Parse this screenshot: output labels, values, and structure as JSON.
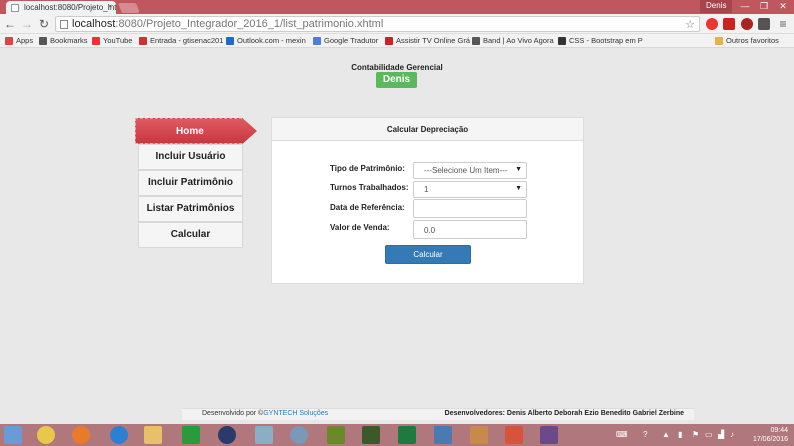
{
  "browser": {
    "tab_title": "localhost:8080/Projeto_Int",
    "tab_close": "×",
    "user_label": "Denis",
    "window_controls": {
      "minimize": "—",
      "maximize": "❐",
      "close": "✕"
    },
    "nav": {
      "back": "←",
      "forward": "→",
      "reload": "↻"
    },
    "url_host": "localhost",
    "url_path": ":8080/Projeto_Integrador_2016_1/list_patrimonio.xhtml",
    "star": "☆",
    "menu": "≡"
  },
  "bookmarks": [
    {
      "label": "Apps",
      "color": "#d44"
    },
    {
      "label": "Bookmarks",
      "color": "#555"
    },
    {
      "label": "YouTube",
      "color": "#e33"
    },
    {
      "label": "Entrada - gtisenac201",
      "color": "#c33"
    },
    {
      "label": "Outlook.com - mexin",
      "color": "#1e6cc7"
    },
    {
      "label": "Google Tradutor",
      "color": "#4a7fd9"
    },
    {
      "label": "Assistir TV Online Grá",
      "color": "#c22"
    },
    {
      "label": "Band | Ao Vivo Agora",
      "color": "#555"
    },
    {
      "label": "CSS - Bootstrap em P",
      "color": "#333"
    },
    {
      "label": "Outros favoritos",
      "color": "#e6b34a"
    }
  ],
  "app": {
    "brand": "Contabilidade Gerencial",
    "user_badge": "Denis",
    "menu": {
      "home": "Home",
      "items": [
        "Incluir Usuário",
        "Incluir Patrimônio",
        "Listar Patrimônios",
        "Calcular"
      ]
    },
    "panel": {
      "title": "Calcular Depreciação",
      "fields": {
        "tipo_label": "Tipo de Patrimônio:",
        "tipo_value": "---Selecione Um Item---",
        "turnos_label": "Turnos Trabalhados:",
        "turnos_value": "1",
        "data_label": "Data de Referência:",
        "data_value": "",
        "valor_label": "Valor de Venda:",
        "valor_value": "0.0"
      },
      "button": "Calcular"
    },
    "footer": {
      "dev_prefix": "Desenvolvido por ©",
      "dev_company": "GYNTECH Soluções",
      "developers": "Desenvolvedores: Denis Alberto Deborah Ezio Benedito Gabriel Zerbine"
    }
  },
  "taskbar": {
    "time": "09:44",
    "date": "17/06/2016"
  }
}
